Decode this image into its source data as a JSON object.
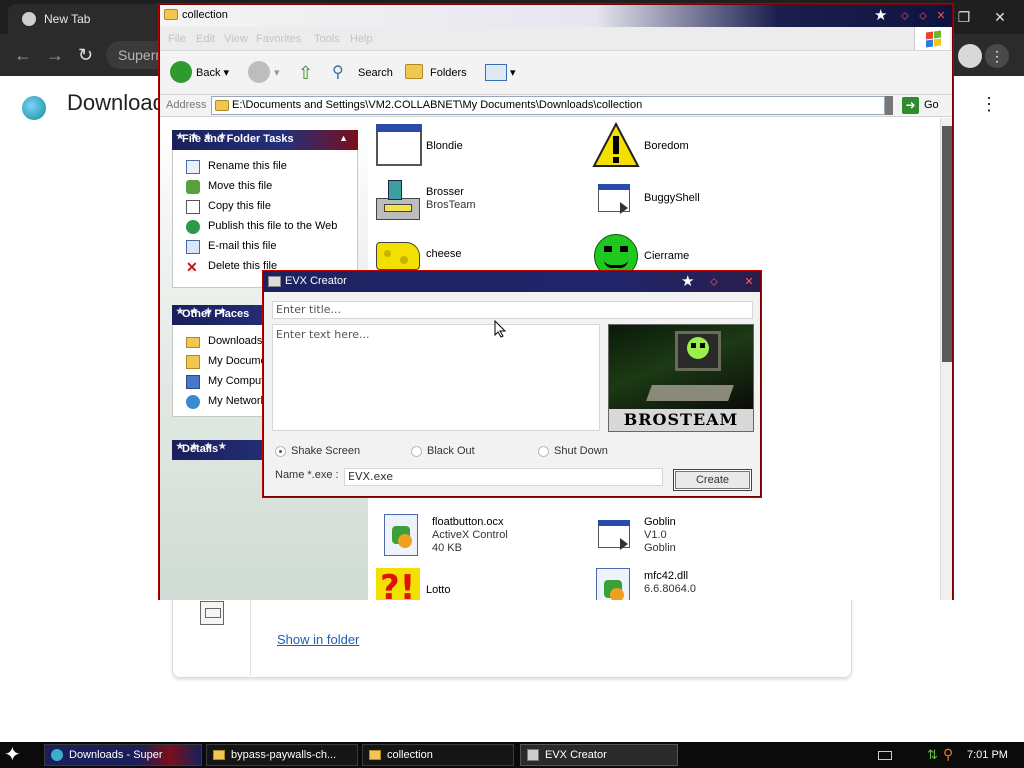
{
  "chrome": {
    "tab_title": "New Tab",
    "omnibox_text": "Superm",
    "page_title": "Download",
    "show_in_folder": "Show in folder"
  },
  "explorer": {
    "title": "collection",
    "menu": [
      "File",
      "Edit",
      "View",
      "Favorites",
      "Tools",
      "Help"
    ],
    "toolbar": {
      "back": "Back",
      "search": "Search",
      "folders": "Folders"
    },
    "address_label": "Address",
    "address_value": "E:\\Documents and Settings\\VM2.COLLABNET\\My Documents\\Downloads\\collection",
    "go_label": "Go",
    "file_tasks": {
      "header": "File and Folder Tasks",
      "items": [
        "Rename this file",
        "Move this file",
        "Copy this file",
        "Publish this file to the Web",
        "E-mail this file",
        "Delete this file"
      ]
    },
    "other_places": {
      "header": "Other Places",
      "items": [
        "Downloads",
        "My Docume",
        "My Compute",
        "My Network"
      ]
    },
    "details": {
      "header": "Details"
    },
    "files": [
      {
        "name": "Blondie",
        "line2": "",
        "line3": "",
        "icon": "window-icon"
      },
      {
        "name": "Boredom",
        "line2": "",
        "line3": "",
        "icon": "warning-icon"
      },
      {
        "name": "Brosser",
        "line2": "BrosTeam",
        "line3": "",
        "icon": "printer-icon"
      },
      {
        "name": "BuggyShell",
        "line2": "",
        "line3": "",
        "icon": "window-icon"
      },
      {
        "name": "cheese",
        "line2": "",
        "line3": "",
        "icon": "cheese-icon"
      },
      {
        "name": "Cierrame",
        "line2": "",
        "line3": "",
        "icon": "smiley-icon"
      },
      {
        "name": "floatbutton.ocx",
        "line2": "ActiveX Control",
        "line3": "40 KB",
        "icon": "activex-icon"
      },
      {
        "name": "Goblin",
        "line2": "V1.0",
        "line3": "Goblin",
        "icon": "window-icon"
      },
      {
        "name": "Lotto",
        "line2": "",
        "line3": "",
        "icon": "lotto-icon"
      },
      {
        "name": "mfc42.dll",
        "line2": "6.6.8064.0",
        "line3": "",
        "icon": "dll-icon"
      }
    ]
  },
  "evx": {
    "title": "EVX Creator",
    "title_placeholder": "Enter title...",
    "text_placeholder": "Enter text here...",
    "image_caption": "BROSTEAM",
    "options": [
      "Shake Screen",
      "Black Out",
      "Shut Down"
    ],
    "selected_option": "Shake Screen",
    "name_label": "Name *.exe :",
    "name_value": "EVX.exe",
    "create_label": "Create"
  },
  "taskbar": {
    "buttons": [
      "Downloads - Super",
      "bypass-paywalls-ch...",
      "collection",
      "EVX Creator"
    ],
    "clock": "7:01 PM"
  },
  "colors": {
    "title_navy": "#1d2260",
    "window_border": "#7a0000",
    "link_blue": "#1a5fb4",
    "chrome_dark": "#1f1f1f"
  }
}
